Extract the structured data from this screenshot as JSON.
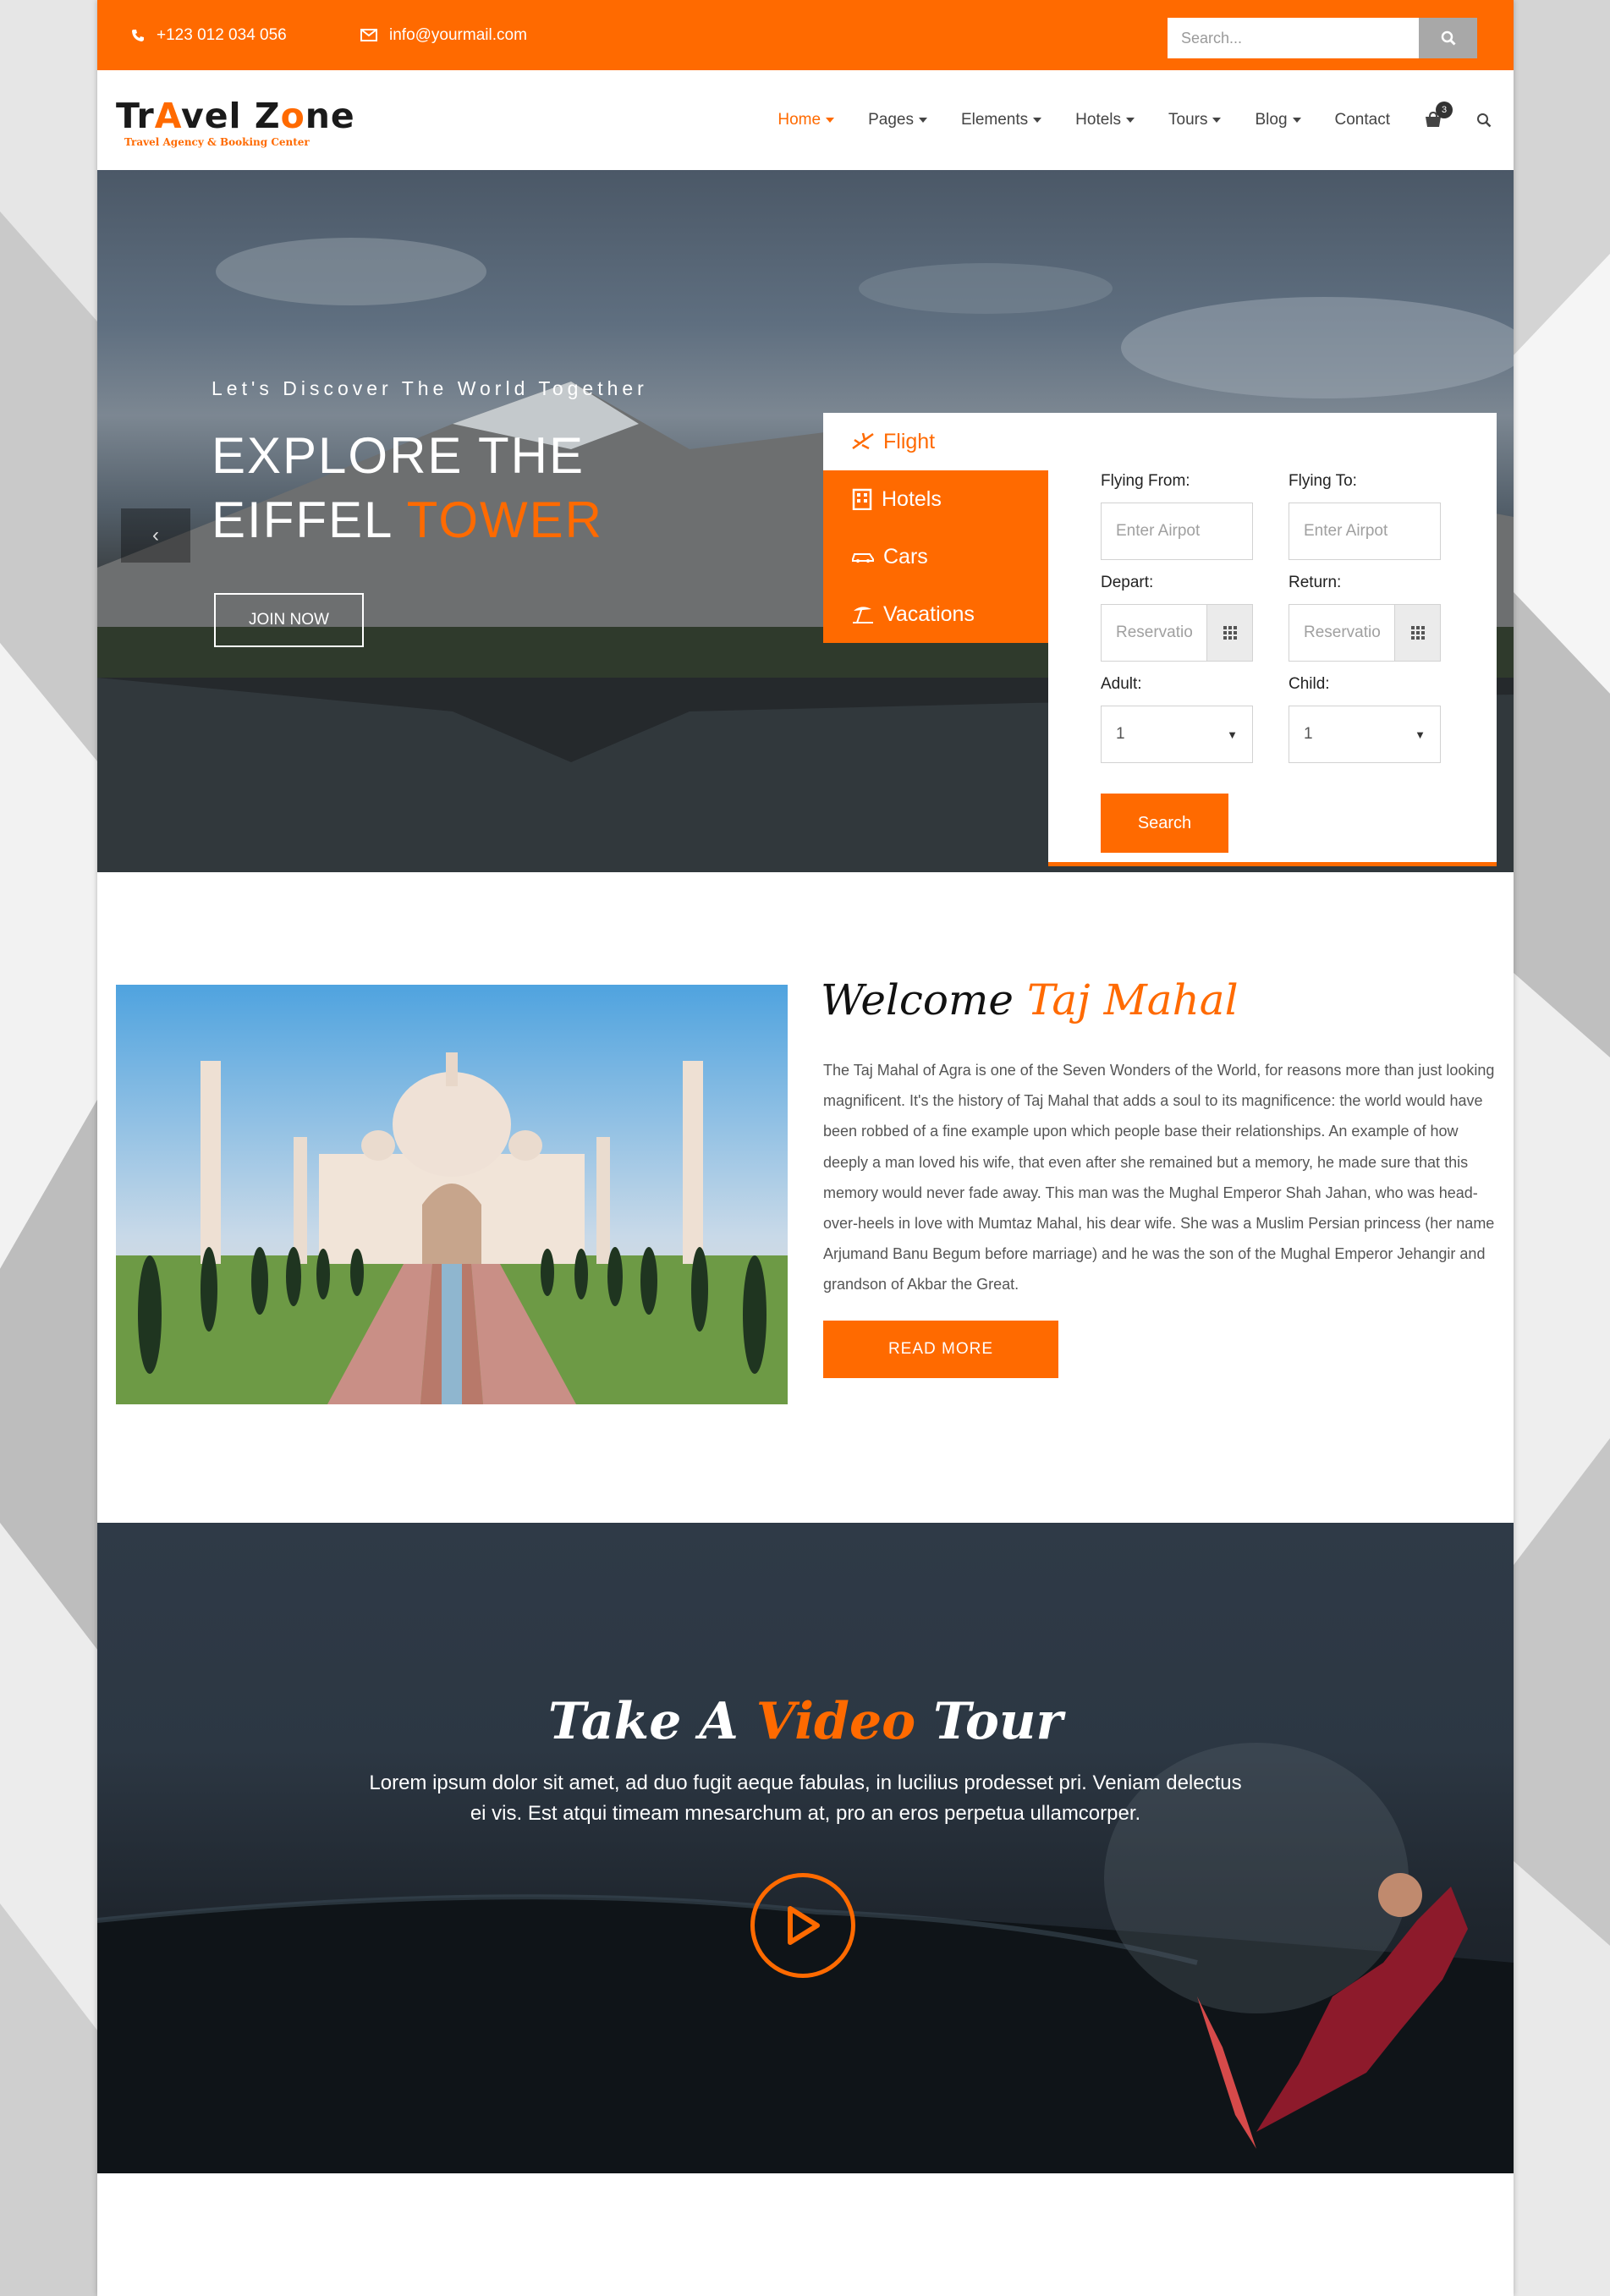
{
  "topbar": {
    "phone": "+123 012 034 056",
    "email": "info@yourmail.com",
    "search_placeholder": "Search..."
  },
  "logo": {
    "name_part1": "Tr",
    "name_part2": "vel Z",
    "name_part3": "ne",
    "tagline": "Travel Agency & Booking Center"
  },
  "nav": {
    "items": [
      {
        "label": "Home",
        "dropdown": true,
        "active": true
      },
      {
        "label": "Pages",
        "dropdown": true
      },
      {
        "label": "Elements",
        "dropdown": true
      },
      {
        "label": "Hotels",
        "dropdown": true
      },
      {
        "label": "Tours",
        "dropdown": true
      },
      {
        "label": "Blog",
        "dropdown": true
      },
      {
        "label": "Contact",
        "dropdown": false
      }
    ],
    "cart_count": "3"
  },
  "hero": {
    "subtitle": "Let's Discover The World Together",
    "title_line1": "EXPLORE THE",
    "title_line2_a": "EIFFEL ",
    "title_line2_b": "TOWER",
    "join_label": "JOIN NOW",
    "prev_arrow": "‹"
  },
  "booking": {
    "tabs": [
      {
        "label": "Flight",
        "icon": "plane-icon",
        "active": true
      },
      {
        "label": "Hotels",
        "icon": "hotel-icon"
      },
      {
        "label": "Cars",
        "icon": "car-icon"
      },
      {
        "label": "Vacations",
        "icon": "beach-icon"
      }
    ],
    "flying_from_label": "Flying From:",
    "flying_to_label": "Flying To:",
    "airport_placeholder": "Enter Airpot",
    "depart_label": "Depart:",
    "return_label": "Return:",
    "date_placeholder": "Reservation",
    "adult_label": "Adult:",
    "child_label": "Child:",
    "adult_value": "1",
    "child_value": "1",
    "search_label": "Search"
  },
  "welcome": {
    "title_a": "Welcome ",
    "title_b": "Taj Mahal",
    "paragraph": "The Taj Mahal of Agra is one of the Seven Wonders of the World, for reasons more than just looking magnificent. It's the history of Taj Mahal that adds a soul to its magnificence: the world would have been robbed of a fine example upon which people base their relationships. An example of how deeply a man loved his wife, that even after she remained but a memory, he made sure that this memory would never fade away. This man was the Mughal Emperor Shah Jahan, who was head-over-heels in love with Mumtaz Mahal, his dear wife. She was a Muslim Persian princess (her name Arjumand Banu Begum before marriage) and he was the son of the Mughal Emperor Jehangir and grandson of Akbar the Great.",
    "read_more": "READ MORE"
  },
  "video": {
    "title_a": "Take A ",
    "title_b": "Video",
    "title_c": " Tour",
    "text": "Lorem ipsum dolor sit amet, ad duo fugit aeque fabulas, in lucilius prodesset pri. Veniam delectus ei vis. Est atqui timeam mnesarchum at, pro an eros perpetua ullamcorper."
  },
  "colors": {
    "accent": "#ff6a00",
    "dark_text": "#222222"
  }
}
